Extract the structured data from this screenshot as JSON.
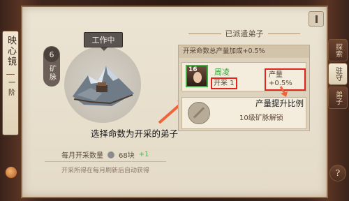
{
  "side_title": "映心镜",
  "side_sub": "一阶",
  "tabs": [
    {
      "label": "探索",
      "active": false
    },
    {
      "label": "驻守",
      "active": true
    },
    {
      "label": "弟子",
      "active": false
    }
  ],
  "help_label": "?",
  "mine": {
    "status": "工作中",
    "level": "6",
    "type": "矿脉"
  },
  "hint_text": "选择命数为开采的弟子",
  "monthly": {
    "label": "每月开采数量",
    "value": "68块",
    "bonus": "+1"
  },
  "footnote": "开采所得在每月刷新后自动获得",
  "dispatched": {
    "title": "已派遣弟子",
    "header": "开采命数总产量加成+0.5%",
    "disciple": {
      "level": "16",
      "name": "周凌",
      "job": "开采 1",
      "bonus": "产量+0.5%"
    },
    "locked_text": "10级矿脉解锁"
  },
  "annotation": "产量提升比例",
  "colors": {
    "highlight": "#e0261e",
    "arrow": "#f0643c",
    "green": "#3a9a3a"
  }
}
